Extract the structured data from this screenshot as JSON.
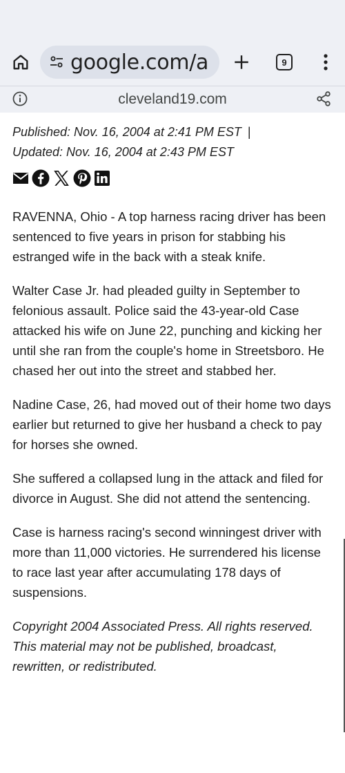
{
  "browser": {
    "url_display": "google.com/a",
    "tab_count": "9",
    "site_name": "cleveland19.com"
  },
  "article": {
    "published": "Published: Nov. 16, 2004 at 2:41 PM EST",
    "separator": "|",
    "updated": "Updated: Nov. 16, 2004 at 2:43 PM EST",
    "paragraphs": [
      "RAVENNA, Ohio - A top harness racing driver has been sentenced to five years in prison for stabbing his estranged wife in the back with a steak knife.",
      "Walter Case Jr. had pleaded guilty in September to felonious assault. Police said the 43-year-old Case attacked his wife on June 22, punching and kicking her until she ran from the couple's home in Streetsboro. He chased her out into the street and stabbed her.",
      "Nadine Case, 26, had moved out of their home two days earlier but returned to give her husband a check to pay for horses she owned.",
      "She suffered a collapsed lung in the attack and filed for divorce in August. She did not attend the sentencing.",
      "Case is harness racing's second winningest driver with more than 11,000 victories. He surrendered his license to race last year after accumulating 178 days of suspensions."
    ],
    "copyright": "Copyright 2004 Associated Press. All rights reserved. This material may not be published, broadcast, rewritten, or redistributed."
  },
  "icons": {
    "home": "home-icon",
    "site_settings": "tune-icon",
    "new_tab": "plus-icon",
    "tabs": "tab-switcher-icon",
    "menu": "more-vert-icon",
    "info": "info-icon",
    "share": "share-icon",
    "social": [
      "email-icon",
      "facebook-icon",
      "x-icon",
      "pinterest-icon",
      "linkedin-icon"
    ]
  },
  "colors": {
    "chrome_bg": "#eef0f5",
    "url_pill": "#dde1ea",
    "text": "#1f1f1f"
  }
}
